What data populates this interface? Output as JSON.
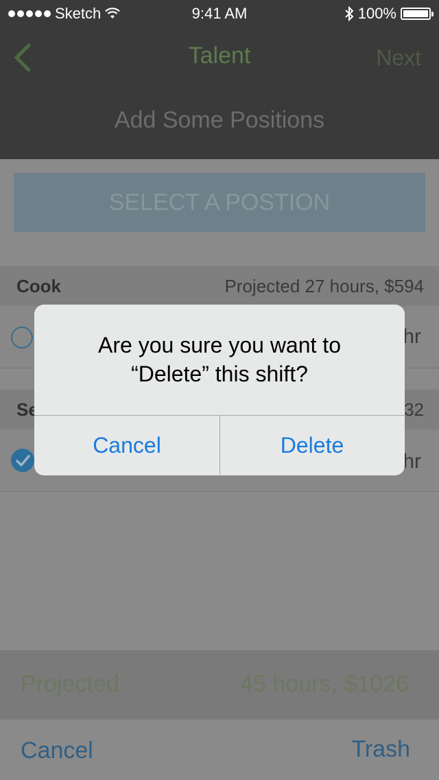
{
  "status_bar": {
    "carrier": "Sketch",
    "time": "9:41 AM",
    "battery": "100%"
  },
  "nav": {
    "title": "Talent",
    "next_label": "Next",
    "subtitle": "Add Some Positions"
  },
  "select_position_label": "SELECT A POSTION",
  "sections": [
    {
      "title": "Cook",
      "projected": "Projected 27 hours, $594",
      "row_trailing": "hr"
    },
    {
      "title": "Se",
      "projected": "32",
      "row_trailing": "hr"
    }
  ],
  "footer": {
    "projected_label": "Projected",
    "projected_value": "45 hours, $1026"
  },
  "toolbar": {
    "cancel_label": "Cancel",
    "trash_label": "Trash"
  },
  "alert": {
    "message_line1": "Are you sure you want to",
    "message_line2": "“Delete” this shift?",
    "cancel_label": "Cancel",
    "delete_label": "Delete"
  },
  "colors": {
    "alert_button": "#1a7be0",
    "nav_title": "#5e7b4e",
    "toolbar_link": "#305f84"
  }
}
